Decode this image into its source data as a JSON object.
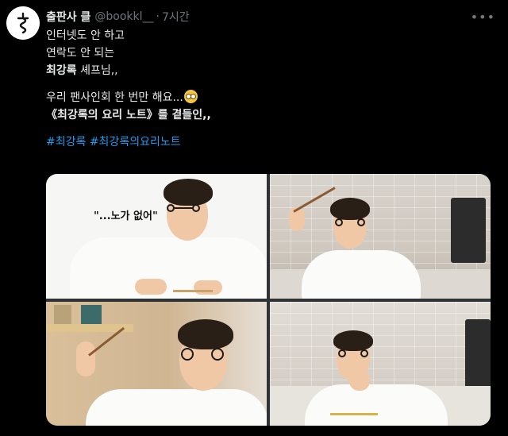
{
  "tweet": {
    "display_name": "출판사 클",
    "handle": "@bookkl__",
    "separator": "·",
    "time": "7시간",
    "more_icon": "more-horizontal-icon",
    "lines": [
      "인터넷도 안 하고",
      "연락도 안 되는"
    ],
    "line3_bold": "최강록",
    "line3_rest": " 셰프님,,",
    "line4": "우리 팬사인회 한 번만 해요...",
    "line4_emoji": "pleading-face-emoji",
    "line5_prefix": "《",
    "line5_bold": "최강록",
    "line5_rest": "의 요리 노트》를 곁들인,,",
    "hashtags": [
      "#최강록",
      "#최강록의요리노트"
    ]
  },
  "media": {
    "photo1_quote": "\"...노가 없어\""
  },
  "colors": {
    "background": "#000000",
    "text": "#e7e9ea",
    "muted": "#71767b",
    "link": "#1d9bf0"
  }
}
